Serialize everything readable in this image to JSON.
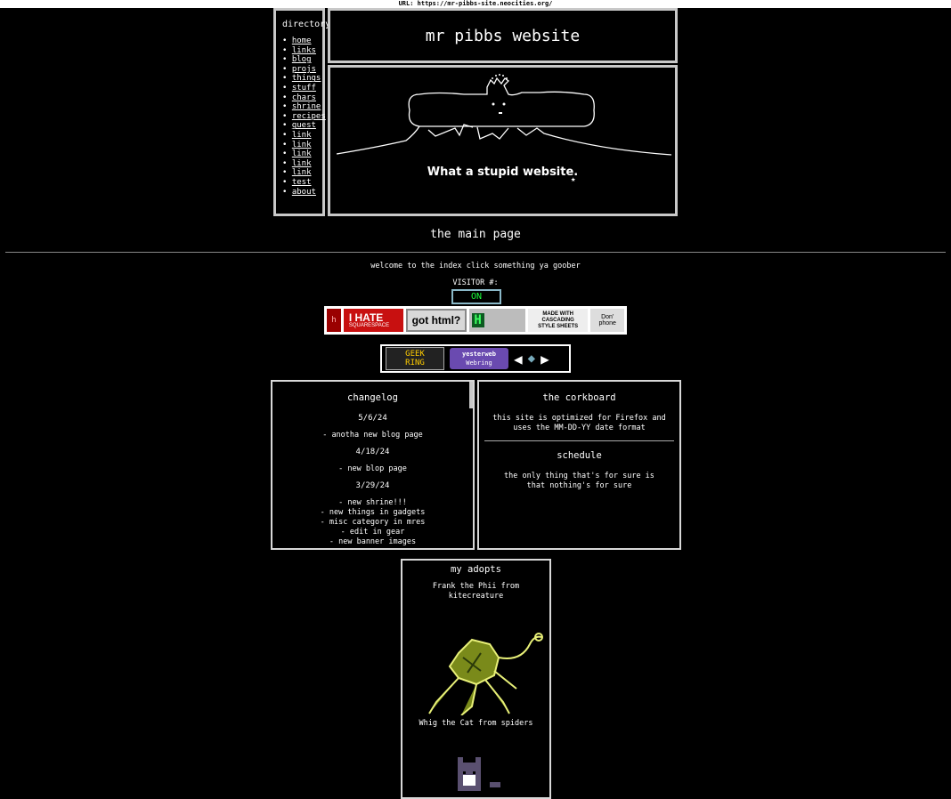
{
  "url_bar": "URL: https://mr-pibbs-site.neocities.org/",
  "directory": {
    "title": "directory",
    "links": [
      "home",
      "links",
      "blog",
      "projs",
      "things",
      "stuff",
      "chars",
      "shrine",
      "recipes",
      "guest",
      "link",
      "link",
      "link",
      "link",
      "link",
      "test",
      "about"
    ]
  },
  "header_title": "mr pibbs website",
  "banner_caption": "What a stupid website.",
  "page_heading": "the main page",
  "welcome": "welcome to the index click something ya goober",
  "visitor": {
    "label": "VISITOR #:",
    "value": "ON"
  },
  "buttons": {
    "hate": "I HATE",
    "hate_sub": "SQUARESPACE",
    "gothtml": "got html?",
    "css1": "MADE WITH",
    "css2": "CASCADING",
    "css3": "STYLE SHEETS",
    "phone1": "Don'",
    "phone2": "phone"
  },
  "webring": {
    "geek1": "GEEK",
    "geek2": "RING",
    "yesterweb": "yesterweb",
    "yw_sub": "Webring"
  },
  "changelog": {
    "title": "changelog",
    "entries": [
      {
        "date": "5/6/24",
        "items": [
          "- anotha new blog page"
        ]
      },
      {
        "date": "4/18/24",
        "items": [
          "- new blop page"
        ]
      },
      {
        "date": "3/29/24",
        "items": [
          "- new shrine!!!",
          "- new things in gadgets",
          "- misc category in mres",
          "- edit in gear",
          "- new banner images"
        ]
      }
    ]
  },
  "corkboard": {
    "title": "the corkboard",
    "note": "this site is optimized for Firefox and uses the MM-DD-YY date format",
    "schedule_title": "schedule",
    "schedule_text": "the only thing that's for sure is that nothing's for sure"
  },
  "adopts": {
    "title": "my adopts",
    "first": "Frank the Phii from kitecreature",
    "second": "Whig the Cat from spiders"
  }
}
